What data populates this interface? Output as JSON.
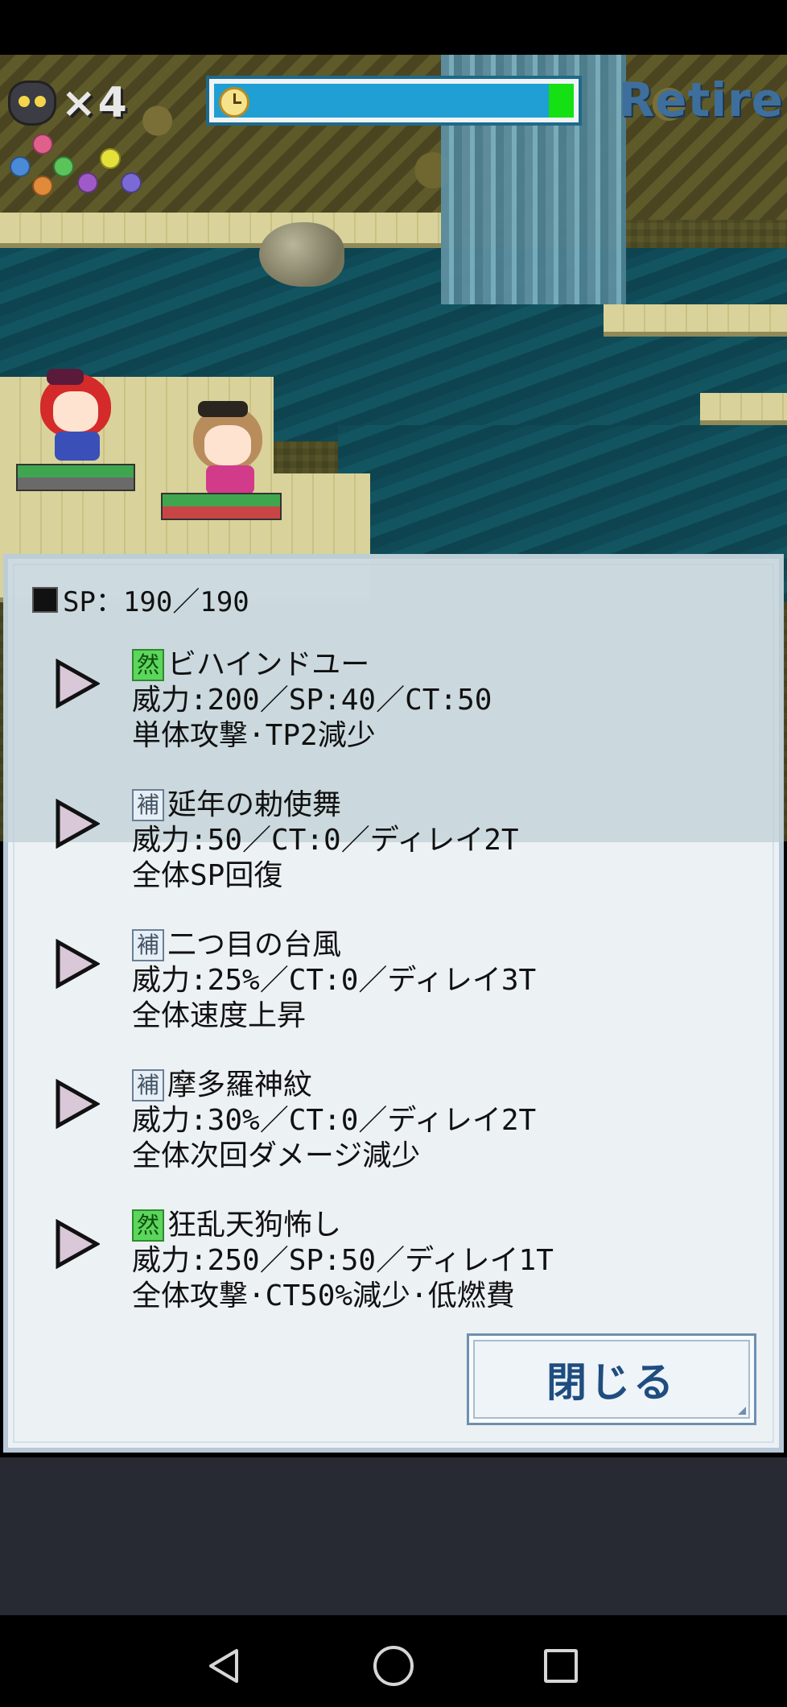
{
  "hud": {
    "lives_count": "×4",
    "retire_label": "Retire",
    "timer_remaining_fraction": 0.07
  },
  "skills_panel": {
    "sp_label": "SP：190／190",
    "skills": [
      {
        "tag": "然",
        "tag_type": "zen",
        "name": "ビハインドユー",
        "stats": "威力:200／SP:40／CT:50",
        "desc": "単体攻撃·TP2減少"
      },
      {
        "tag": "補",
        "tag_type": "ho",
        "name": "延年の勅使舞",
        "stats": "威力:50／CT:0／ディレイ2T",
        "desc": "全体SP回復"
      },
      {
        "tag": "補",
        "tag_type": "ho",
        "name": "二つ目の台風",
        "stats": "威力:25%／CT:0／ディレイ3T",
        "desc": "全体速度上昇"
      },
      {
        "tag": "補",
        "tag_type": "ho",
        "name": "摩多羅神紋",
        "stats": "威力:30%／CT:0／ディレイ2T",
        "desc": "全体次回ダメージ減少"
      },
      {
        "tag": "然",
        "tag_type": "zen",
        "name": "狂乱天狗怖し",
        "stats": "威力:250／SP:50／ディレイ1T",
        "desc": "全体攻撃·CT50%減少·低燃費"
      }
    ],
    "close_label": "閉じる"
  },
  "colors": {
    "timer_bar": "#1f9fd4",
    "timer_fill": "#14e014",
    "tag_zen": "#5cd65c",
    "tag_ho": "#e6eef6",
    "retire_text": "#3e6f9c",
    "close_text": "#1f4d80"
  },
  "icons": [
    "owl-icon",
    "orb-icon",
    "clock-icon",
    "sp-icon",
    "play-arrow-icon",
    "back-icon",
    "home-icon",
    "recent-apps-icon"
  ]
}
